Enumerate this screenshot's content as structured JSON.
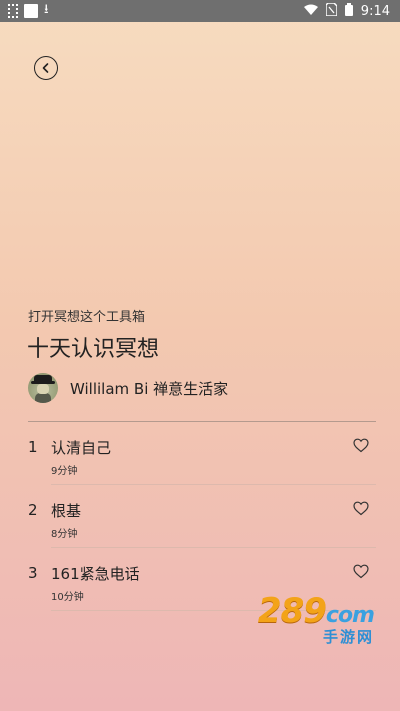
{
  "status_bar": {
    "time": "9:14"
  },
  "header": {
    "back_icon": "back-arrow-circle-icon"
  },
  "course": {
    "subtitle": "打开冥想这个工具箱",
    "title": "十天认识冥想",
    "author": "Willilam Bi 禅意生活家"
  },
  "lessons": [
    {
      "num": "1",
      "name": "认清自己",
      "duration": "9分钟"
    },
    {
      "num": "2",
      "name": "根基",
      "duration": "8分钟"
    },
    {
      "num": "3",
      "name": "161紧急电话",
      "duration": "10分钟"
    }
  ],
  "watermark": {
    "main_number": "289",
    "main_suffix": "com",
    "sub": "手游网"
  },
  "colors": {
    "accent_orange": "#f3a318",
    "accent_blue": "#3aa1e0"
  }
}
